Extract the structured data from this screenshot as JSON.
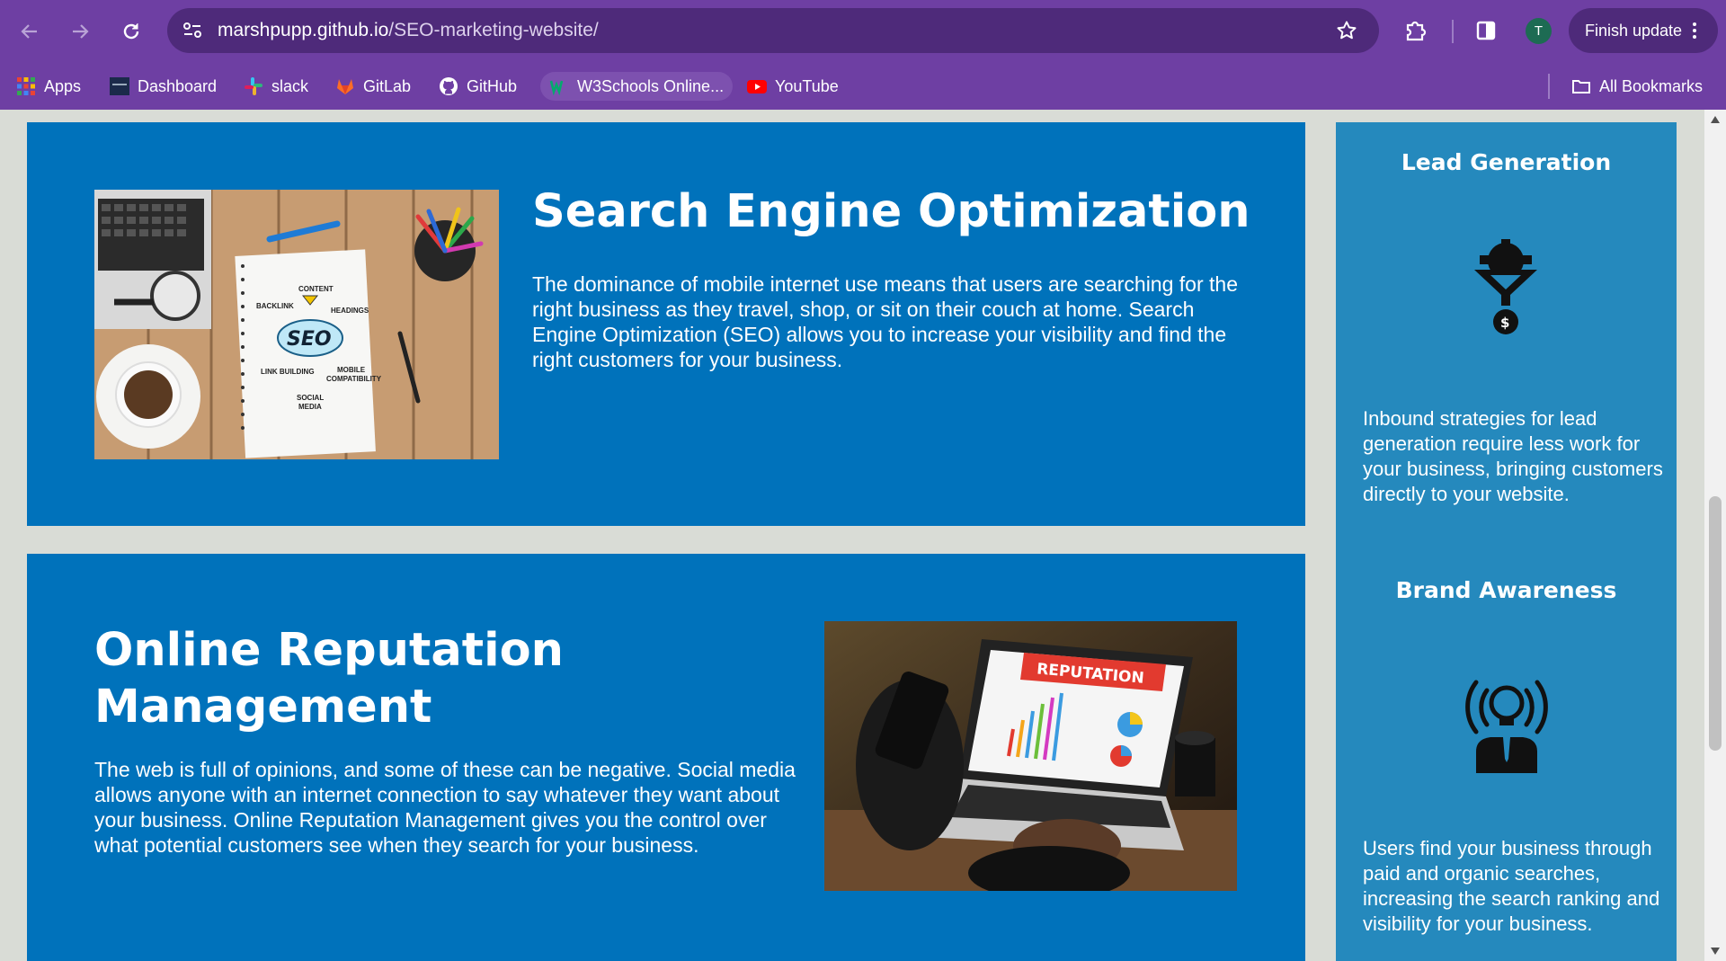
{
  "browser": {
    "url_host": "marshpupp.github.io",
    "url_path": "/SEO-marketing-website/",
    "avatar_letter": "T",
    "finish_update_label": "Finish update",
    "bookmarks": [
      {
        "label": "Apps",
        "icon": "apps-grid-icon"
      },
      {
        "label": "Dashboard",
        "icon": "dashboard-favicon-icon"
      },
      {
        "label": "slack",
        "icon": "slack-icon"
      },
      {
        "label": "GitLab",
        "icon": "gitlab-icon"
      },
      {
        "label": "GitHub",
        "icon": "github-icon"
      },
      {
        "label": "W3Schools Online...",
        "icon": "w3schools-icon"
      },
      {
        "label": "YouTube",
        "icon": "youtube-icon"
      }
    ],
    "all_bookmarks_label": "All Bookmarks"
  },
  "colors": {
    "browser_frame": "#6e3fa3",
    "card_background": "#0072bb",
    "aside_background": "#2589bd",
    "page_background": "#d9dcd6"
  },
  "main": {
    "sections": [
      {
        "title": "Search Engine Optimization",
        "body": "The dominance of mobile internet use means that users are searching for the right business as they travel, shop, or sit on their couch at home. Search Engine Optimization (SEO) allows you to increase your visibility and find the right customers for your business.",
        "image_words": [
          "CONTENT",
          "BACKLINK",
          "HEADINGS",
          "SEO",
          "LINK BUILDING",
          "MOBILE",
          "COMPATIBILITY",
          "SOCIAL",
          "MEDIA"
        ]
      },
      {
        "title": "Online Reputation Management",
        "body": "The web is full of opinions, and some of these can be negative. Social media allows anyone with an internet connection to say whatever they want about your business. Online Reputation Management gives you the control over what potential customers see when they search for your business.",
        "image_words": [
          "REPUTATION"
        ]
      }
    ]
  },
  "aside": {
    "items": [
      {
        "title": "Lead Generation",
        "icon": "lead-generation-funnel-icon",
        "body": "Inbound strategies for lead generation require less work for your business, bringing customers directly to your website."
      },
      {
        "title": "Brand Awareness",
        "icon": "brand-awareness-lightbulb-icon",
        "body": "Users find your business through paid and organic searches, increasing the search ranking and visibility for your business."
      }
    ]
  }
}
